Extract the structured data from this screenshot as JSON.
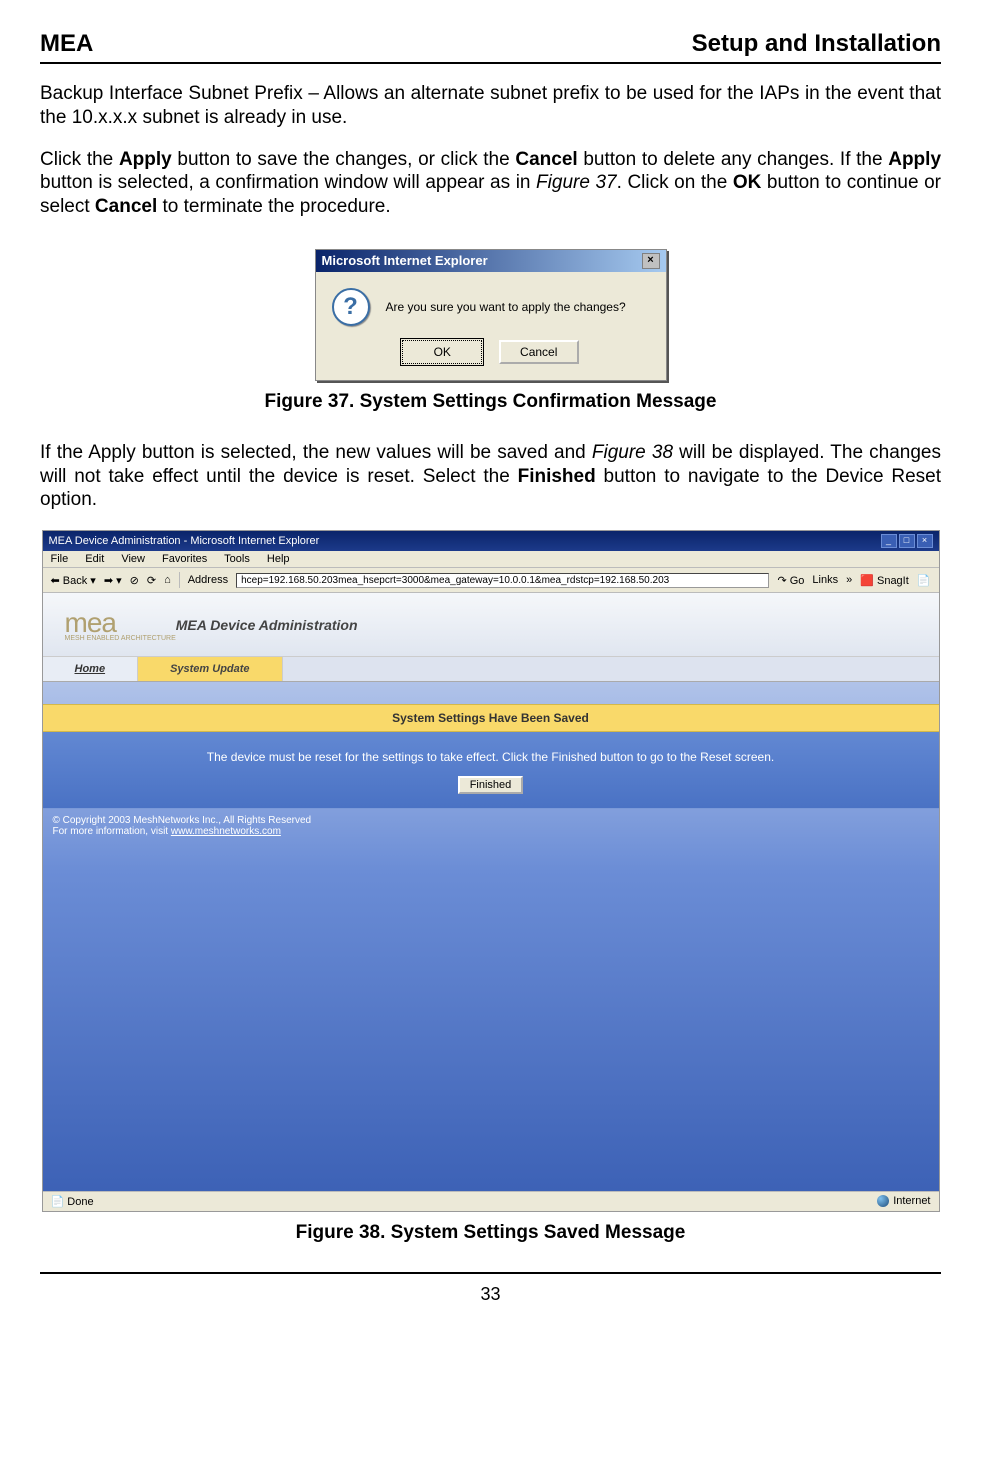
{
  "header": {
    "left": "MEA",
    "right": "Setup and Installation"
  },
  "para1": "Backup Interface Subnet Prefix – Allows an alternate subnet prefix to be used for the IAPs in the event that the 10.x.x.x subnet is already in use.",
  "para2_parts": {
    "t1": "Click the ",
    "b1": "Apply",
    "t2": " button to save the changes, or click the ",
    "b2": "Cancel",
    "t3": " button to delete any changes. If the ",
    "b3": "Apply",
    "t4": " button is selected, a confirmation window will appear as in ",
    "i1": "Figure 37",
    "t5": ".  Click on the ",
    "b4": "OK",
    "t6": " button to continue or select ",
    "b5": "Cancel",
    "t7": " to terminate the procedure."
  },
  "dialog": {
    "title": "Microsoft Internet Explorer",
    "message": "Are you sure you want to apply the changes?",
    "ok": "OK",
    "cancel": "Cancel"
  },
  "fig37_caption": "Figure 37.      System Settings Confirmation Message",
  "para3_parts": {
    "t1": "If the Apply button is selected, the new values will be saved and ",
    "i1": "Figure 38",
    "t2": " will be displayed. The changes will not take effect until the device is reset.  Select the ",
    "b1": "Finished",
    "t3": " button to navigate to the Device Reset option."
  },
  "screenshot": {
    "titlebar": "MEA Device Administration - Microsoft Internet Explorer",
    "menus": [
      "File",
      "Edit",
      "View",
      "Favorites",
      "Tools",
      "Help"
    ],
    "back": "Back",
    "address_label": "Address",
    "address_value": "hcep=192.168.50.203mea_hsepcrt=3000&mea_gateway=10.0.0.1&mea_rdstcp=192.168.50.203",
    "go": "Go",
    "links": "Links",
    "snagit": "SnagIt",
    "logo_main": "mea",
    "logo_sub": "MESH ENABLED\nARCHITECTURE",
    "banner_title": "MEA Device Administration",
    "tab_home": "Home",
    "tab_system": "System Update",
    "yellow_heading": "System Settings Have Been Saved",
    "message_body": "The device must be reset for the settings to take effect. Click the Finished button to go to the Reset screen.",
    "finished_btn": "Finished",
    "copyright": "© Copyright 2003 MeshNetworks Inc., All Rights Reserved",
    "moreinfo": "For more information, visit ",
    "moreinfo_link": "www.meshnetworks.com",
    "status_left": "Done",
    "status_right": "Internet"
  },
  "fig38_caption": "Figure 38.      System Settings Saved Message",
  "page_number": "33"
}
